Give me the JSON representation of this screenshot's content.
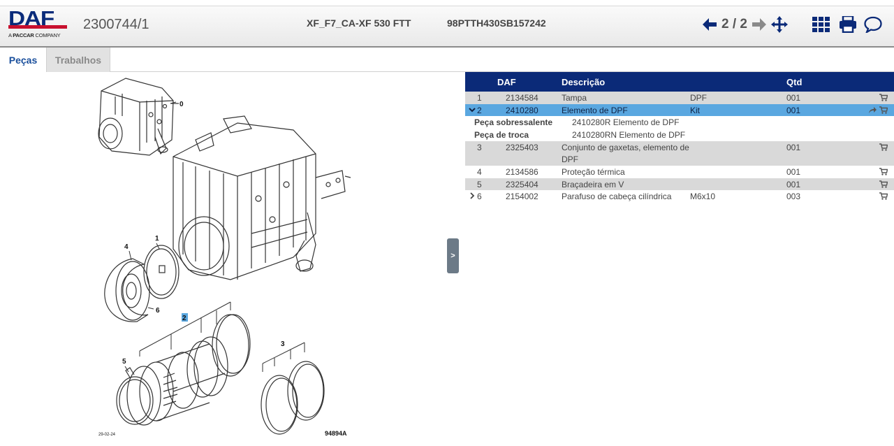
{
  "header": {
    "logo_text": "DAF",
    "logo_sub_prefix": "A",
    "logo_sub_brand": "PACCAR",
    "logo_sub_suffix": "COMPANY",
    "doc_id": "2300744/1",
    "model": "XF_F7_CA-XF 530 FTT",
    "vin": "98PTTH430SB157242",
    "pager": "2 / 2"
  },
  "tabs": [
    {
      "label": "Peças"
    },
    {
      "label": "Trabalhos"
    }
  ],
  "drawing": {
    "labels": [
      "0",
      "1",
      "2",
      "3",
      "4",
      "5",
      "6"
    ],
    "date": "29-02-24",
    "code": "94894A"
  },
  "collapse_label": ">",
  "table": {
    "headers": {
      "daf": "DAF",
      "descricao": "Descrição",
      "qtd": "Qtd"
    },
    "rows": [
      {
        "pos": "1",
        "daf": "2134584",
        "desc": "Tampa",
        "extra": "DPF",
        "qty": "001",
        "expander": ""
      },
      {
        "pos": "2",
        "daf": "2410280",
        "desc": "Elemento de DPF",
        "extra": "Kit",
        "qty": "001",
        "expander": "⌄"
      },
      {
        "pos": "3",
        "daf": "2325403",
        "desc": "Conjunto de gaxetas, elemento de DPF",
        "extra": "",
        "qty": "001",
        "expander": ""
      },
      {
        "pos": "4",
        "daf": "2134586",
        "desc": "Proteção térmica",
        "extra": "",
        "qty": "001",
        "expander": ""
      },
      {
        "pos": "5",
        "daf": "2325404",
        "desc": "Braçadeira em V",
        "extra": "",
        "qty": "001",
        "expander": ""
      },
      {
        "pos": "6",
        "daf": "2154002",
        "desc": "Parafuso de cabeça cilíndrica",
        "extra": "M6x10",
        "qty": "003",
        "expander": "›"
      }
    ],
    "details": [
      {
        "key": "Peça sobressalente",
        "value": "2410280R Elemento de DPF"
      },
      {
        "key": "Peça de troca",
        "value": "2410280RN Elemento de DPF"
      }
    ]
  },
  "colors": {
    "header_blue": "#0b2a78",
    "selected_row": "#5aa7e0",
    "grey_row": "#d9d9d9",
    "logo_red": "#c8102e"
  }
}
